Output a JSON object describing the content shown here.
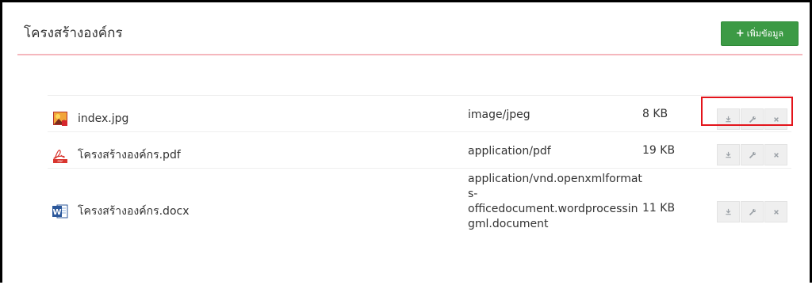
{
  "header": {
    "title": "โครงสร้างองค์กร",
    "add_button_label": "เพิ่มข้อมูล",
    "add_button_plus": "+"
  },
  "colors": {
    "accent_green": "#3c9a45",
    "divider_pink": "#f5b7bd",
    "highlight_red": "#e3141b"
  },
  "files": [
    {
      "name": "index.jpg",
      "mime": "image/jpeg",
      "size": "8 KB",
      "icon": "jpg-image-icon"
    },
    {
      "name": "โครงสร้างองค์กร.pdf",
      "mime": "application/pdf",
      "size": "19 KB",
      "icon": "pdf-icon"
    },
    {
      "name": "โครงสร้างองค์กร.docx",
      "mime": "application/vnd.openxmlformats-officedocument.wordprocessingml.document",
      "mime_lines": [
        "application/vnd.openxmlformat",
        "s-",
        "officedocument.wordprocessin",
        "gml.document"
      ],
      "size": "11 KB",
      "icon": "word-docx-icon"
    }
  ],
  "actions": [
    {
      "name": "download",
      "icon": "download-icon",
      "glyph": "⭳"
    },
    {
      "name": "edit",
      "icon": "wrench-icon",
      "glyph": "🔧"
    },
    {
      "name": "delete",
      "icon": "close-icon",
      "glyph": "✖"
    }
  ]
}
